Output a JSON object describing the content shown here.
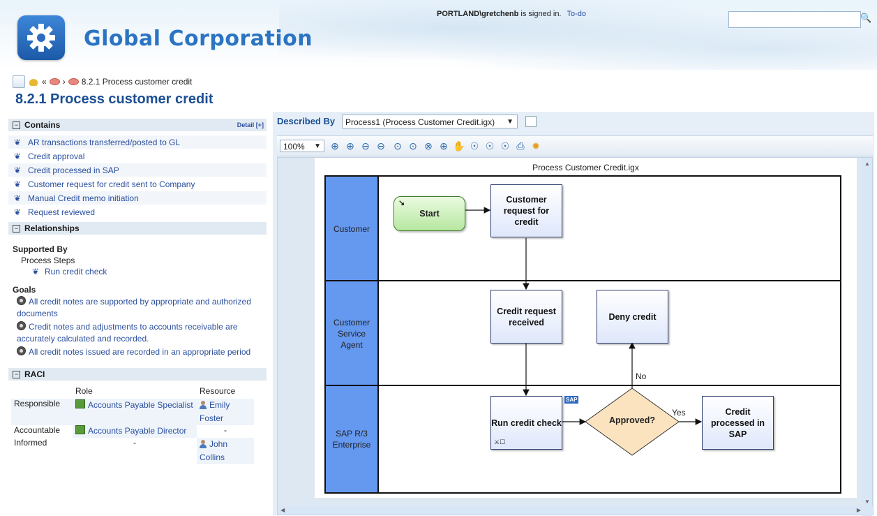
{
  "header": {
    "brand": "Global Corporation",
    "signed_user": "PORTLAND\\gretchenb",
    "signed_suffix": " is signed in.",
    "todo": "To-do",
    "search_placeholder": ""
  },
  "breadcrumb": {
    "prev": "«",
    "sep": "›",
    "current": "8.2.1 Process customer credit"
  },
  "page_title": "8.2.1 Process customer credit",
  "contains": {
    "label": "Contains",
    "detail": "Detail [+]",
    "items": [
      "AR transactions transferred/posted to GL",
      "Credit approval",
      "Credit processed in SAP",
      "Customer request for credit sent to Company",
      "Manual Credit memo initiation",
      "Request reviewed"
    ]
  },
  "relationships": {
    "label": "Relationships",
    "supported_by": "Supported By",
    "process_steps": "Process Steps",
    "step": "Run credit check",
    "goals_label": "Goals",
    "goals": [
      "All credit notes are supported by appropriate and authorized documents",
      "Credit notes and adjustments to accounts receivable are accurately calculated and recorded.",
      "All credit notes issued are recorded in an appropriate period"
    ]
  },
  "raci": {
    "label": "RACI",
    "col_role": "Role",
    "col_resource": "Resource",
    "rows": [
      {
        "type": "Responsible",
        "role": "Accounts Payable Specialist",
        "resource": "Emily Foster"
      },
      {
        "type": "Accountable",
        "role": "Accounts Payable Director",
        "resource": "-"
      },
      {
        "type": "Informed",
        "role": "-",
        "resource": "John Collins"
      }
    ]
  },
  "described_by": {
    "label": "Described By",
    "selected": "Process1 (Process Customer Credit.igx)"
  },
  "toolbar": {
    "zoom": "100%"
  },
  "diagram": {
    "title": "Process Customer Credit.igx",
    "lanes": [
      "Customer",
      "Customer Service Agent",
      "SAP R/3 Enterprise"
    ],
    "start": "Start",
    "n_request": "Customer request for credit",
    "n_received": "Credit request received",
    "n_deny": "Deny credit",
    "n_run": "Run credit check",
    "n_approved": "Approved?",
    "n_processed": "Credit processed in SAP",
    "label_no": "No",
    "label_yes": "Yes",
    "sap_badge": "SAP"
  }
}
